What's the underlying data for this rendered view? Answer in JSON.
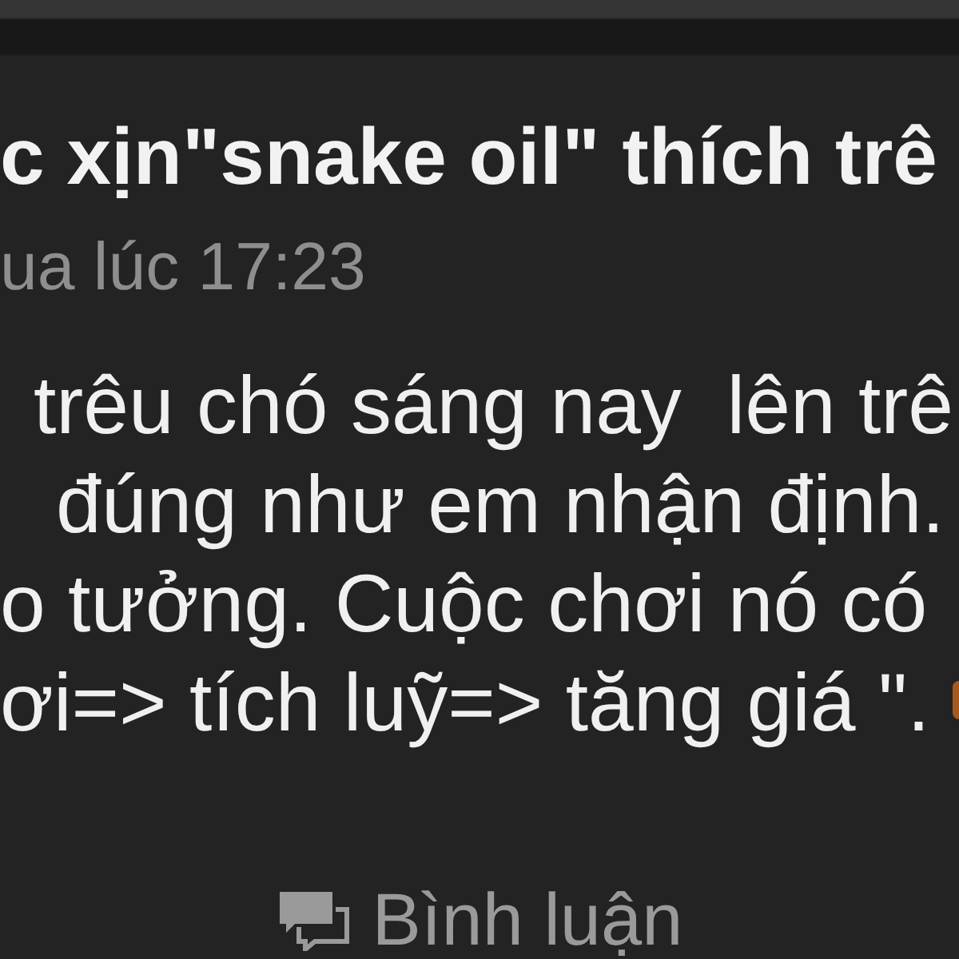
{
  "post": {
    "title": "c xịn\"snake oil\" thích trê",
    "meta": "ua lúc 17:23",
    "body_lines": [
      "trêu chó sáng nay  lên trê",
      "đúng như em nhận định.",
      "o tưởng. Cuộc chơi nó có",
      "ơi=> tích luỹ=> tăng giá \"."
    ]
  },
  "comment_button": {
    "label": "Bình luận"
  }
}
